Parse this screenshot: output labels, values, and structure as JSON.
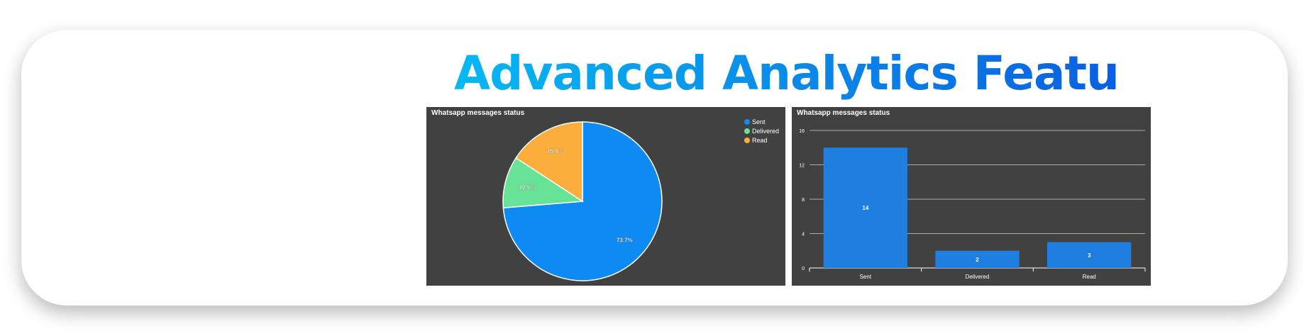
{
  "headline": "Advanced Analytics Feature",
  "colors": {
    "sent": "#0d8bf2",
    "delivered": "#66e395",
    "read": "#fcae3d",
    "bar": "#1f7fe0",
    "panel_bg": "#414141"
  },
  "chart_data": [
    {
      "type": "pie",
      "title": "Whatsapp messages status",
      "categories": [
        "Sent",
        "Delivered",
        "Read"
      ],
      "values": [
        14,
        2,
        3
      ],
      "labels": [
        "73.7%",
        "10.5%",
        "15.8%"
      ],
      "legend": "top-right"
    },
    {
      "type": "bar",
      "title": "Whatsapp messages status",
      "categories": [
        "Sent",
        "Delivered",
        "Read"
      ],
      "values": [
        14,
        2,
        3
      ],
      "ylim": [
        0,
        16
      ],
      "yticks": [
        "0",
        "4",
        "8",
        "12",
        "16"
      ],
      "grid": true
    }
  ]
}
